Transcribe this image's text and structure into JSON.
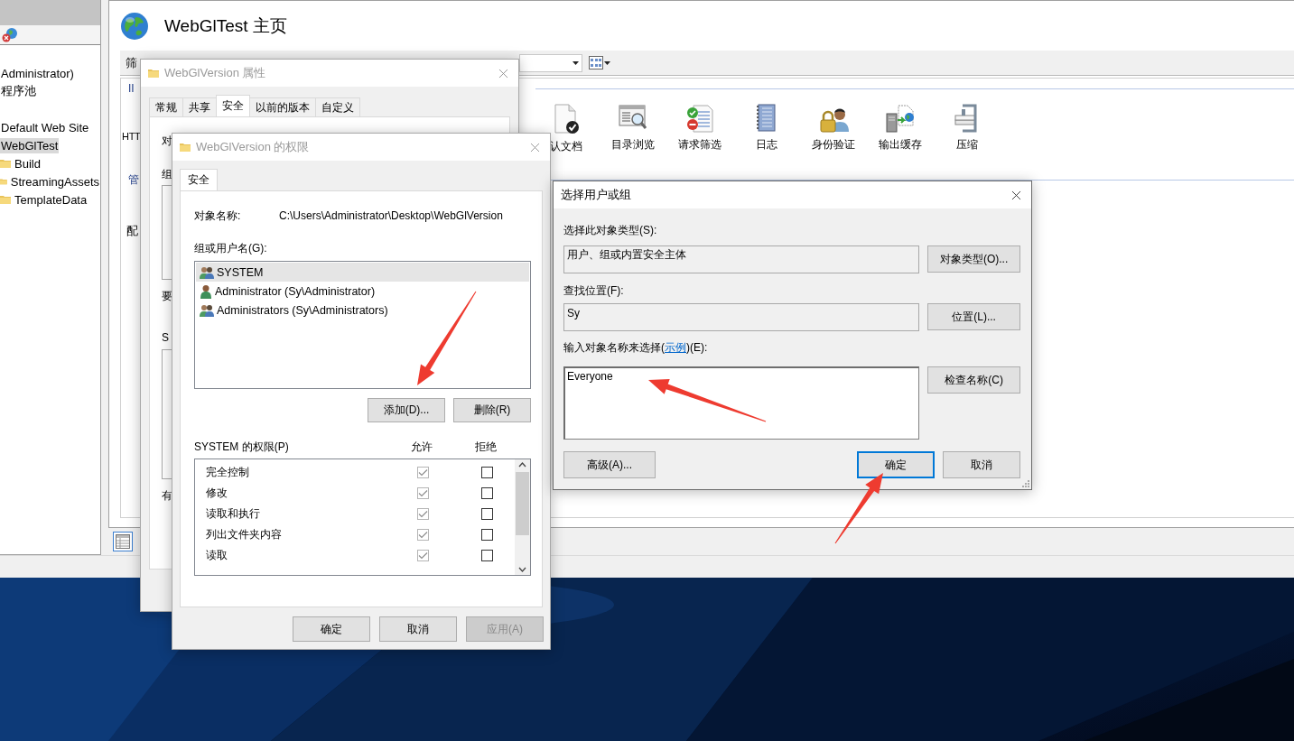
{
  "iis_manager": {
    "tree": [
      {
        "label": "Administrator)",
        "selected": false
      },
      {
        "label": "程序池",
        "selected": false
      },
      {
        "label": "Default Web Site",
        "selected": false
      },
      {
        "label": "WebGlTest",
        "selected": true,
        "children": [
          {
            "label": "Build",
            "selected": false
          },
          {
            "label": "StreamingAssets",
            "selected": false
          },
          {
            "label": "TemplateData",
            "selected": false
          }
        ]
      }
    ],
    "title": "WebGlTest 主页",
    "filter_label": "筛",
    "group_heading": "II",
    "first_feature": "HTT",
    "second_group_heading": "管",
    "third_row_label": "配",
    "features": [
      {
        "label": "认文档"
      },
      {
        "label": "目录浏览"
      },
      {
        "label": "请求筛选"
      },
      {
        "label": "日志"
      },
      {
        "label": "身份验证"
      },
      {
        "label": "输出缓存"
      },
      {
        "label": "压缩"
      }
    ],
    "bottom_tab_visible": true
  },
  "properties_dialog": {
    "title": "WebGlVersion 属性",
    "active": false,
    "tabs": [
      {
        "label": "常规",
        "selected": false
      },
      {
        "label": "共享",
        "selected": false
      },
      {
        "label": "安全",
        "selected": true
      },
      {
        "label": "以前的版本",
        "selected": false
      },
      {
        "label": "自定义",
        "selected": false
      }
    ],
    "fragments": [
      "对",
      "组",
      "要",
      "S",
      "有"
    ]
  },
  "permissions_dialog": {
    "title": "WebGlVersion 的权限",
    "active": false,
    "tabs": [
      {
        "label": "安全",
        "selected": true
      }
    ],
    "object_name_label": "对象名称:",
    "object_name": "C:\\Users\\Administrator\\Desktop\\WebGlVersion",
    "users_label": "组或用户名(G):",
    "users": [
      {
        "name": "SYSTEM",
        "kind": "group",
        "selected": true
      },
      {
        "name": "Administrator (Sy\\Administrator)",
        "kind": "user",
        "selected": false
      },
      {
        "name": "Administrators (Sy\\Administrators)",
        "kind": "group",
        "selected": false
      }
    ],
    "user_buttons": [
      {
        "label": "添加(D)...",
        "disabled": false
      },
      {
        "label": "删除(R)",
        "disabled": false
      }
    ],
    "permissions_label": "SYSTEM 的权限(P)",
    "allow_header": "允许",
    "deny_header": "拒绝",
    "permissions": [
      {
        "name": "完全控制",
        "allow": true,
        "allow_disabled": true,
        "deny": false
      },
      {
        "name": "修改",
        "allow": true,
        "allow_disabled": true,
        "deny": false
      },
      {
        "name": "读取和执行",
        "allow": true,
        "allow_disabled": true,
        "deny": false
      },
      {
        "name": "列出文件夹内容",
        "allow": true,
        "allow_disabled": true,
        "deny": false
      },
      {
        "name": "读取",
        "allow": true,
        "allow_disabled": true,
        "deny": false
      }
    ],
    "buttons": [
      {
        "label": "确定",
        "disabled": false
      },
      {
        "label": "取消",
        "disabled": false
      },
      {
        "label": "应用(A)",
        "disabled": true
      }
    ]
  },
  "select_dialog": {
    "title": "选择用户或组",
    "active": true,
    "object_type_label": "选择此对象类型(S):",
    "object_type": "用户、组或内置安全主体",
    "object_type_button": "对象类型(O)...",
    "location_label": "查找位置(F):",
    "location": "Sy",
    "location_button": "位置(L)...",
    "names_label_before": "输入对象名称来选择(",
    "names_link": "示例",
    "names_label_after": ")(E):",
    "names": "Everyone",
    "check_button": "检查名称(C)",
    "advanced_button": "高级(A)...",
    "buttons": [
      {
        "label": "确定",
        "focused": true
      },
      {
        "label": "取消",
        "focused": false
      }
    ]
  }
}
